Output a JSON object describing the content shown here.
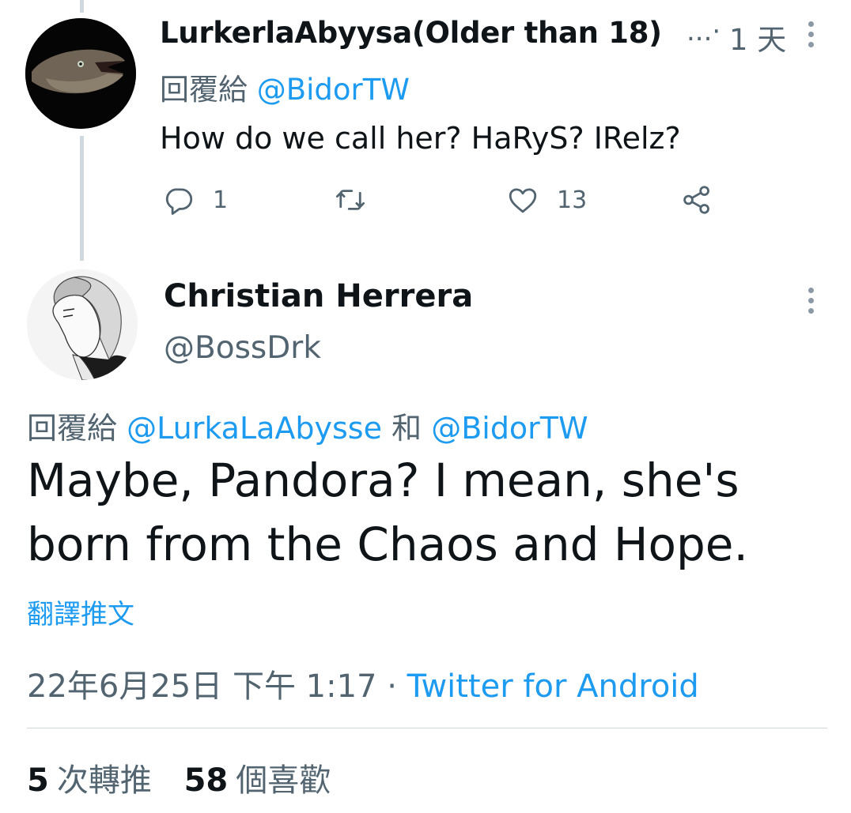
{
  "reply": {
    "display_name": "LurkerlaAbyysa(Older than 18)",
    "truncation": "...·",
    "time": "1 天",
    "replying_label": "回覆給",
    "replying_handle": "@BidorTW",
    "text": "How do we call her? HaRyS? IRelz?",
    "actions": {
      "reply_count": "1",
      "retweet_count": "",
      "like_count": "13"
    }
  },
  "tweet": {
    "display_name": "Christian Herrera",
    "handle": "@BossDrk",
    "replying_label": "回覆給",
    "replying_handle_1": "@LurkaLaAbysse",
    "replying_and": "和",
    "replying_handle_2": "@BidorTW",
    "text": "Maybe, Pandora? I mean, she's born from the Chaos and Hope.",
    "translate_label": "翻譯推文",
    "timestamp": "22年6月25日 下午 1:17",
    "separator": "·",
    "source": "Twitter for Android",
    "retweets_count": "5",
    "retweets_label": "次轉推",
    "likes_count": "58",
    "likes_label": "個喜歡"
  },
  "colors": {
    "link": "#1d9bf0",
    "muted": "#536471",
    "thread_line": "#cfd9de"
  },
  "icons": [
    "reply-icon",
    "retweet-icon",
    "like-icon",
    "share-icon",
    "more-icon"
  ]
}
